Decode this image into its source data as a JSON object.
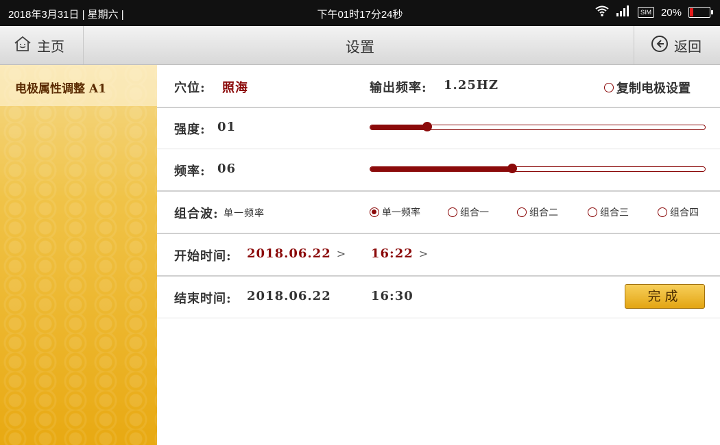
{
  "status_bar": {
    "date": "2018年3月31日 | 星期六 |",
    "time": "下午01时17分24秒",
    "sim_label": "SIM",
    "battery_text": "20%",
    "battery_color": "#e31b1b"
  },
  "header": {
    "home_label": "主页",
    "title": "设置",
    "back_label": "返回"
  },
  "sidebar": {
    "items": [
      {
        "label": "电极属性调整 A1"
      }
    ]
  },
  "main": {
    "acupoint_label": "穴位:",
    "acupoint_value": "照海",
    "output_freq_label": "输出频率:",
    "output_freq_value": "1.25HZ",
    "copy_label": "复制电极设置",
    "intensity_label": "强度:",
    "intensity_value": "01",
    "intensity_level": 0.17,
    "frequency_label": "频率:",
    "frequency_value": "06",
    "frequency_level": 0.425,
    "combo_label": "组合波:",
    "combo_value": "单一频率",
    "combo_options": [
      "单一频率",
      "组合一",
      "组合二",
      "组合三",
      "组合四"
    ],
    "combo_selected": 0,
    "start_label": "开始时间:",
    "start_date": "2018.06.22",
    "start_time": "16:22",
    "end_label": "结束时间:",
    "end_date": "2018.06.22",
    "end_time": "16:30",
    "done_label": "完成"
  },
  "colors": {
    "accent": "#8b0a0a",
    "sidebar": "#f0c348"
  }
}
